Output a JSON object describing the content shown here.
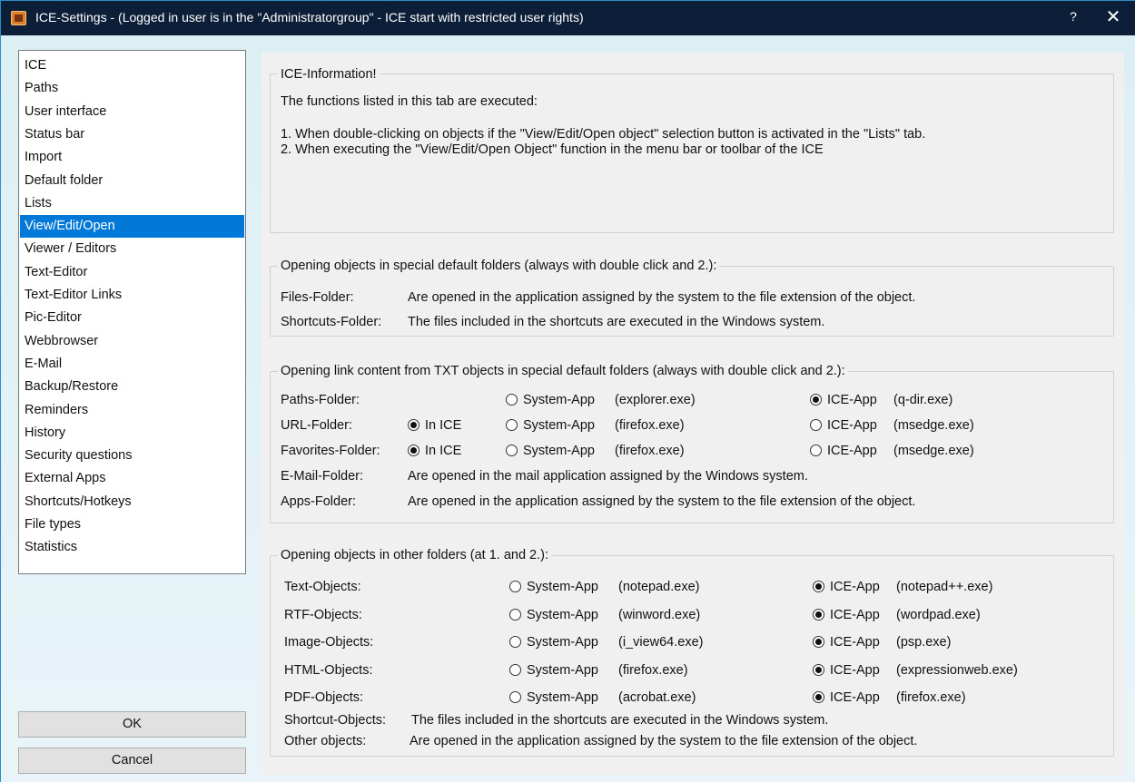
{
  "window": {
    "title": "ICE-Settings - (Logged in user is in the \"Administratorgroup\" - ICE start with restricted user rights)",
    "help_label": "?",
    "close_label": "✕"
  },
  "sidebar": {
    "items": [
      {
        "label": "ICE"
      },
      {
        "label": "Paths"
      },
      {
        "label": "User interface"
      },
      {
        "label": "Status bar"
      },
      {
        "label": "Import"
      },
      {
        "label": "Default folder"
      },
      {
        "label": "Lists"
      },
      {
        "label": "View/Edit/Open",
        "selected": true
      },
      {
        "label": "Viewer / Editors"
      },
      {
        "label": "Text-Editor"
      },
      {
        "label": "Text-Editor Links"
      },
      {
        "label": "Pic-Editor"
      },
      {
        "label": "Webbrowser"
      },
      {
        "label": "E-Mail"
      },
      {
        "label": "Backup/Restore"
      },
      {
        "label": "Reminders"
      },
      {
        "label": "History"
      },
      {
        "label": "Security questions"
      },
      {
        "label": "External Apps"
      },
      {
        "label": "Shortcuts/Hotkeys"
      },
      {
        "label": "File types"
      },
      {
        "label": "Statistics"
      }
    ]
  },
  "buttons": {
    "ok": "OK",
    "cancel": "Cancel"
  },
  "info": {
    "title": "ICE-Information!",
    "line1": "The functions listed in this tab are executed:",
    "line2": "1. When double-clicking on objects if the \"View/Edit/Open object\" selection button is activated in the \"Lists\" tab.",
    "line3": "2. When executing the \"View/Edit/Open Object\" function in the menu bar or toolbar of the ICE"
  },
  "special_folders": {
    "title": "Opening objects in special default folders (always with double click and 2.):",
    "rows": [
      {
        "label": "Files-Folder:",
        "desc": "Are opened in the application assigned by the system to the file extension of the object."
      },
      {
        "label": "Shortcuts-Folder:",
        "desc": "The files included in the shortcuts are executed in the Windows system."
      }
    ]
  },
  "link_content": {
    "title": "Opening link content from TXT objects in special default folders (always with double click and 2.):",
    "rows": [
      {
        "label": "Paths-Folder:",
        "in_ice": null,
        "system_app": "System-App",
        "system_exe": "(explorer.exe)",
        "ice_app": "ICE-App",
        "ice_exe": "(q-dir.exe)",
        "selected": "ice"
      },
      {
        "label": "URL-Folder:",
        "in_ice": "In ICE",
        "system_app": "System-App",
        "system_exe": "(firefox.exe)",
        "ice_app": "ICE-App",
        "ice_exe": "(msedge.exe)",
        "selected": "in_ice"
      },
      {
        "label": "Favorites-Folder:",
        "in_ice": "In ICE",
        "system_app": "System-App",
        "system_exe": "(firefox.exe)",
        "ice_app": "ICE-App",
        "ice_exe": "(msedge.exe)",
        "selected": "in_ice"
      }
    ],
    "text_rows": [
      {
        "label": "E-Mail-Folder:",
        "desc": "Are opened in the mail application assigned by the Windows system."
      },
      {
        "label": "Apps-Folder:",
        "desc": "Are opened in the application assigned by the system to the file extension of the object."
      }
    ]
  },
  "other_folders": {
    "title": "Opening objects in other folders (at 1. and 2.):",
    "rows": [
      {
        "label": "Text-Objects:",
        "system_app": "System-App",
        "system_exe": "(notepad.exe)",
        "ice_app": "ICE-App",
        "ice_exe": "(notepad++.exe)",
        "selected": "ice"
      },
      {
        "label": "RTF-Objects:",
        "system_app": "System-App",
        "system_exe": "(winword.exe)",
        "ice_app": "ICE-App",
        "ice_exe": "(wordpad.exe)",
        "selected": "ice"
      },
      {
        "label": "Image-Objects:",
        "system_app": "System-App",
        "system_exe": "(i_view64.exe)",
        "ice_app": "ICE-App",
        "ice_exe": "(psp.exe)",
        "selected": "ice"
      },
      {
        "label": "HTML-Objects:",
        "system_app": "System-App",
        "system_exe": "(firefox.exe)",
        "ice_app": "ICE-App",
        "ice_exe": "(expressionweb.exe)",
        "selected": "ice"
      },
      {
        "label": "PDF-Objects:",
        "system_app": "System-App",
        "system_exe": "(acrobat.exe)",
        "ice_app": "ICE-App",
        "ice_exe": "(firefox.exe)",
        "selected": "ice"
      }
    ],
    "text_rows": [
      {
        "label": "Shortcut-Objects:",
        "desc": "The files included in the shortcuts are executed in the Windows system."
      },
      {
        "label": "Other objects:",
        "desc": "Are opened in the application assigned by the system to the file extension of the object."
      }
    ]
  }
}
